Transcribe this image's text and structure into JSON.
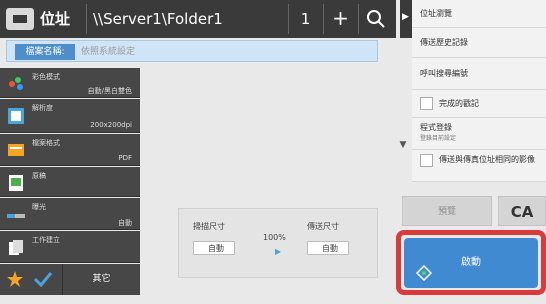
{
  "address_bar": {
    "label": "位址",
    "path": "\\\\Server1\\Folder1",
    "count": "1",
    "add_symbol": "+"
  },
  "file_name": {
    "label": "檔案名稱:",
    "placeholder": "依照系統設定"
  },
  "left_menu": [
    {
      "title": "彩色模式",
      "value": "自動/黑白雙色",
      "icon": "color-mode-icon"
    },
    {
      "title": "解析度",
      "value": "200x200dpi",
      "icon": "resolution-icon"
    },
    {
      "title": "檔案格式",
      "value": "PDF",
      "icon": "file-format-icon"
    },
    {
      "title": "原稿",
      "value": "",
      "icon": "original-icon"
    },
    {
      "title": "曝光",
      "value": "自動",
      "icon": "exposure-icon"
    },
    {
      "title": "工作建立",
      "value": "",
      "icon": "job-build-icon"
    }
  ],
  "bottom_bar": {
    "other_label": "其它"
  },
  "middle": {
    "scan_size_label": "掃描尺寸",
    "send_size_label": "傳送尺寸",
    "scan_size_value": "自動",
    "send_size_value": "自動",
    "ratio": "100%"
  },
  "right_panel": {
    "items": [
      {
        "label": "位址瀏覽"
      },
      {
        "label": "傳送歷史記錄"
      },
      {
        "label": "呼叫搜尋編號"
      },
      {
        "label": "完成的戳記",
        "checkbox": true
      },
      {
        "label": "程式登錄",
        "sub": "登錄目前設定"
      },
      {
        "label": "傳送與傳真位址相同的影像",
        "checkbox": true
      }
    ],
    "preview_label": "預覽",
    "ca_label": "CA",
    "start_label": "啟動"
  },
  "colors": {
    "accent": "#3f8ad0",
    "highlight": "#d93b3b",
    "menu_bg": "#474747"
  }
}
